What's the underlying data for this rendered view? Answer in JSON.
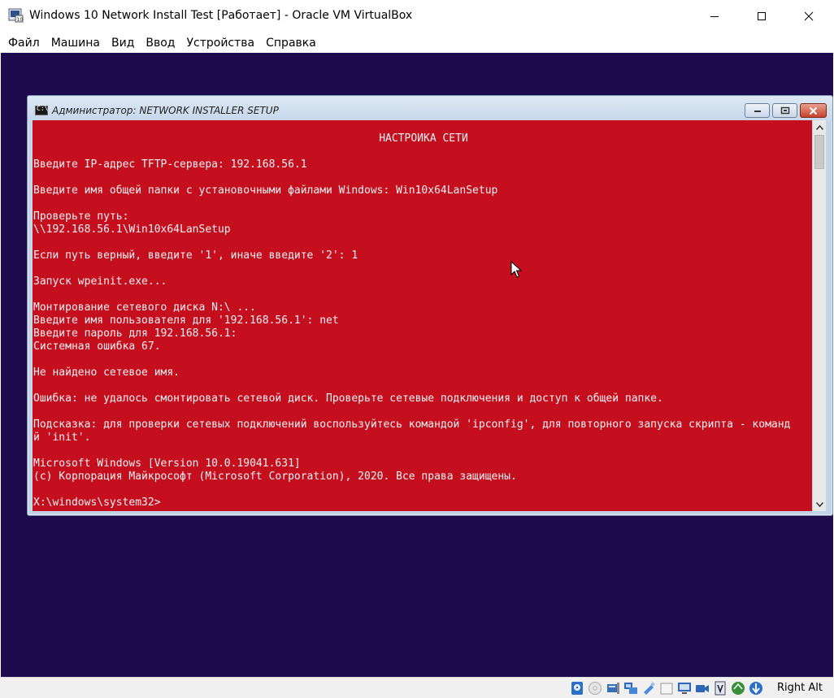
{
  "vbox": {
    "title": "Windows 10 Network Install Test [Работает] - Oracle VM VirtualBox",
    "app_icon": "virtualbox-icon",
    "window_controls": [
      "minimize-icon",
      "maximize-icon",
      "close-icon"
    ],
    "menu": [
      {
        "label": "Файл"
      },
      {
        "label": "Машина"
      },
      {
        "label": "Вид"
      },
      {
        "label": "Ввод"
      },
      {
        "label": "Устройства"
      },
      {
        "label": "Справка"
      }
    ],
    "screen_background": "#1d0b4d"
  },
  "console": {
    "title": "Администратор:  NETWORK INSTALLER SETUP",
    "icon": "cmd-icon",
    "icon_text": "C:\\",
    "background": "#c50f1f",
    "foreground": "#f2f2f2",
    "lines": [
      "НАСТРОЙКА СЕТИ",
      "",
      "Введите IP-адрес TFTP-сервера: 192.168.56.1",
      "",
      "Введите имя общей папки с установочными файлами Windows: Win10x64LanSetup",
      "",
      "Проверьте путь:",
      "\\\\192.168.56.1\\Win10x64LanSetup",
      "",
      "Если путь верный, введите '1', иначе введите '2': 1",
      "",
      "Запуск wpeinit.exe...",
      "",
      "Монтирование сетевого диска N:\\ ...",
      "Введите имя пользователя для '192.168.56.1': net",
      "Введите пароль для 192.168.56.1:",
      "Системная ошибка 67.",
      "",
      "Не найдено сетевое имя.",
      "",
      "Ошибка: не удалось смонтировать сетевой диск. Проверьте сетевые подключения и доступ к общей папке.",
      "",
      "Подсказка: для проверки сетевых подключений воспользуйтесь командой 'ipconfig', для повторного запуска скрипта - команд",
      "й 'init'.",
      "",
      "Microsoft Windows [Version 10.0.19041.631]",
      "(c) Корпорация Майкрософт (Microsoft Corporation), 2020. Все права защищены.",
      "",
      "X:\\windows\\system32>"
    ]
  },
  "statusbar": {
    "icons": [
      "hard-disk-icon",
      "optical-drive-icon",
      "audio-icon",
      "network-icon",
      "usb-icon",
      "shared-folders-icon",
      "display-icon",
      "video-capture-icon",
      "cpu-virtualization-icon",
      "mouse-integration-icon",
      "keyboard-capture-icon"
    ],
    "host_key": "Right Alt"
  }
}
